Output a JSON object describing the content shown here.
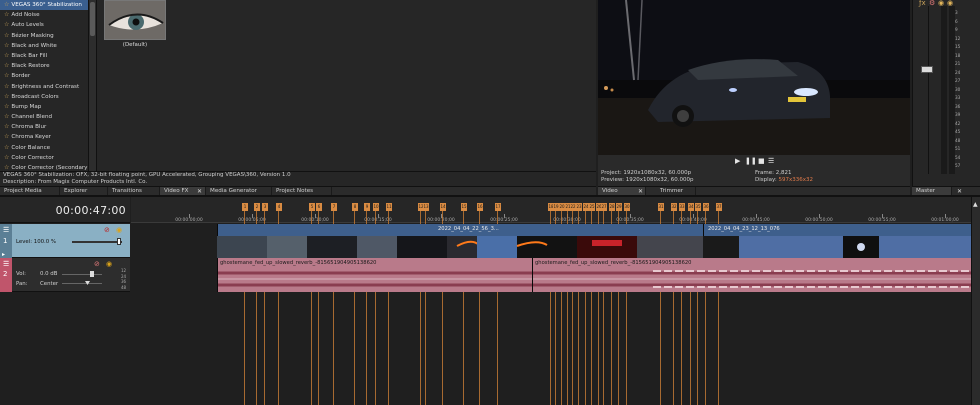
{
  "fx_list": {
    "items": [
      "VEGAS 360° Stabilization",
      "Add Noise",
      "Auto Levels",
      "Bézier Masking",
      "Black and White",
      "Black Bar Fill",
      "Black Restore",
      "Border",
      "Brightness and Contrast",
      "Broadcast Colors",
      "Bump Map",
      "Channel Blend",
      "Chroma Blur",
      "Chroma Keyer",
      "Color Balance",
      "Color Corrector",
      "Color Corrector (Secondary)"
    ],
    "selected_index": 0
  },
  "preset": {
    "label": "(Default)"
  },
  "description": {
    "line1": "VEGAS 360° Stabilization: OFX, 32-bit floating point, GPU Accelerated, Grouping VEGAS\\360, Version 1.0",
    "line2": "Description: From Magix Computer Products Intl. Co."
  },
  "tabs_left": [
    "Project Media",
    "Explorer",
    "Transitions",
    "Video FX",
    "Media Generator",
    "Project Notes"
  ],
  "tabs_mid": [
    "Video Preview",
    "Trimmer"
  ],
  "tabs_right": [
    "Master Bus"
  ],
  "preview": {
    "project_label": "Project:",
    "project_value": "1920x1080x32, 60.000p",
    "preview_label": "Preview:",
    "preview_value": "1920x1080x32, 60.000p",
    "display_label": "Display:",
    "display_value": "597x336x32",
    "frame_label": "Frame:",
    "frame_value": "2,821"
  },
  "master": {
    "db_scale": [
      "3",
      "6",
      "9",
      "12",
      "15",
      "18",
      "21",
      "24",
      "27",
      "30",
      "33",
      "36",
      "39",
      "42",
      "45",
      "48",
      "51",
      "54",
      "57"
    ]
  },
  "timeline": {
    "timecode": "00:00:47:00",
    "ruler_labels": [
      "00:00:00;00",
      "00:00:05;00",
      "00:00:10;00",
      "00:00:15;00",
      "00:00:20;00",
      "00:00:25;00",
      "00:00:30;00",
      "00:00:35;00",
      "00:00:40;00",
      "00:00:45;00",
      "00:00:50;00",
      "00:00:55;00",
      "00:01:00;00",
      "00:01:05;00",
      "00:01:10;00",
      "00:01:15;00"
    ],
    "markers": [
      "1",
      "2",
      "3",
      "4",
      "5",
      "6",
      "7",
      "8",
      "9",
      "10",
      "11",
      "12",
      "13",
      "14",
      "15",
      "16",
      "17",
      "18",
      "19",
      "20",
      "21",
      "22",
      "23",
      "24",
      "25",
      "26",
      "27",
      "28",
      "29",
      "30",
      "31",
      "32",
      "33",
      "34",
      "35",
      "36",
      "37"
    ]
  },
  "video_track": {
    "number": "1",
    "level_label": "Level: 100.0 %",
    "clip1_title": "2022_04_04_22_56_3...",
    "clip2_title": "2022_04_04_23_12_13_076"
  },
  "audio_track": {
    "number": "2",
    "vol_label": "Vol:",
    "vol_value": "0.0 dB",
    "pan_label": "Pan:",
    "pan_value": "Center",
    "meter_labels": [
      "12",
      "24",
      "36",
      "48"
    ],
    "clip1_title": "ghostemane_fed_up_slowed_reverb_-815651904905138620",
    "clip2_title": "ghostemane_fed_up_slowed_reverb_-815651904905138620"
  },
  "colors": {
    "video_clip": "#4d6fa6",
    "audio_clip": "#b97a8a",
    "marker": "#d98b42",
    "track1_header": "#8ab0c4"
  }
}
